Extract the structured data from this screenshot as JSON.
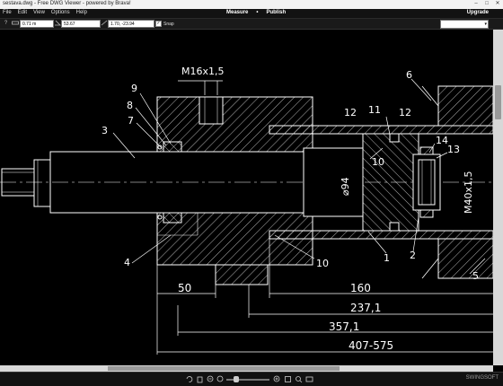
{
  "window": {
    "title": "sestava.dwg - Free DWG Viewer - powered by Brava!",
    "minimize_glyph": "–",
    "maximize_glyph": "□",
    "close_glyph": "✕"
  },
  "menu": {
    "items": [
      "File",
      "Edit",
      "View",
      "Options",
      "Help"
    ],
    "measure": "Measure",
    "bullet": "•",
    "publish": "Publish",
    "upgrade": "Upgrade"
  },
  "toolbar": {
    "help_glyph": "?",
    "field_1": "0.71 m",
    "field_2": "53.67",
    "field_3": "1.70, -23.94",
    "snap_label": "Snap",
    "snap_checked": "✓",
    "dropdown_arrow": "▾"
  },
  "drawing": {
    "thread_label": "M16x1,5",
    "thread_label_right": "M40x1,5",
    "diameter_label": "⌀94",
    "callouts": [
      "9",
      "8",
      "7",
      "3",
      "4",
      "10",
      "12",
      "11",
      "12",
      "6",
      "10",
      "14",
      "13",
      "1",
      "2",
      "5"
    ],
    "dim_50": "50",
    "dim_160": "160",
    "dim_237": "237,1",
    "dim_357": "357,1",
    "dim_407": "407-575"
  },
  "statusbar": {
    "brand": "SWINGSOFT"
  },
  "colors": {
    "canvas_bg": "#000000",
    "line": "#ffffff",
    "ui_dark": "#121212"
  }
}
